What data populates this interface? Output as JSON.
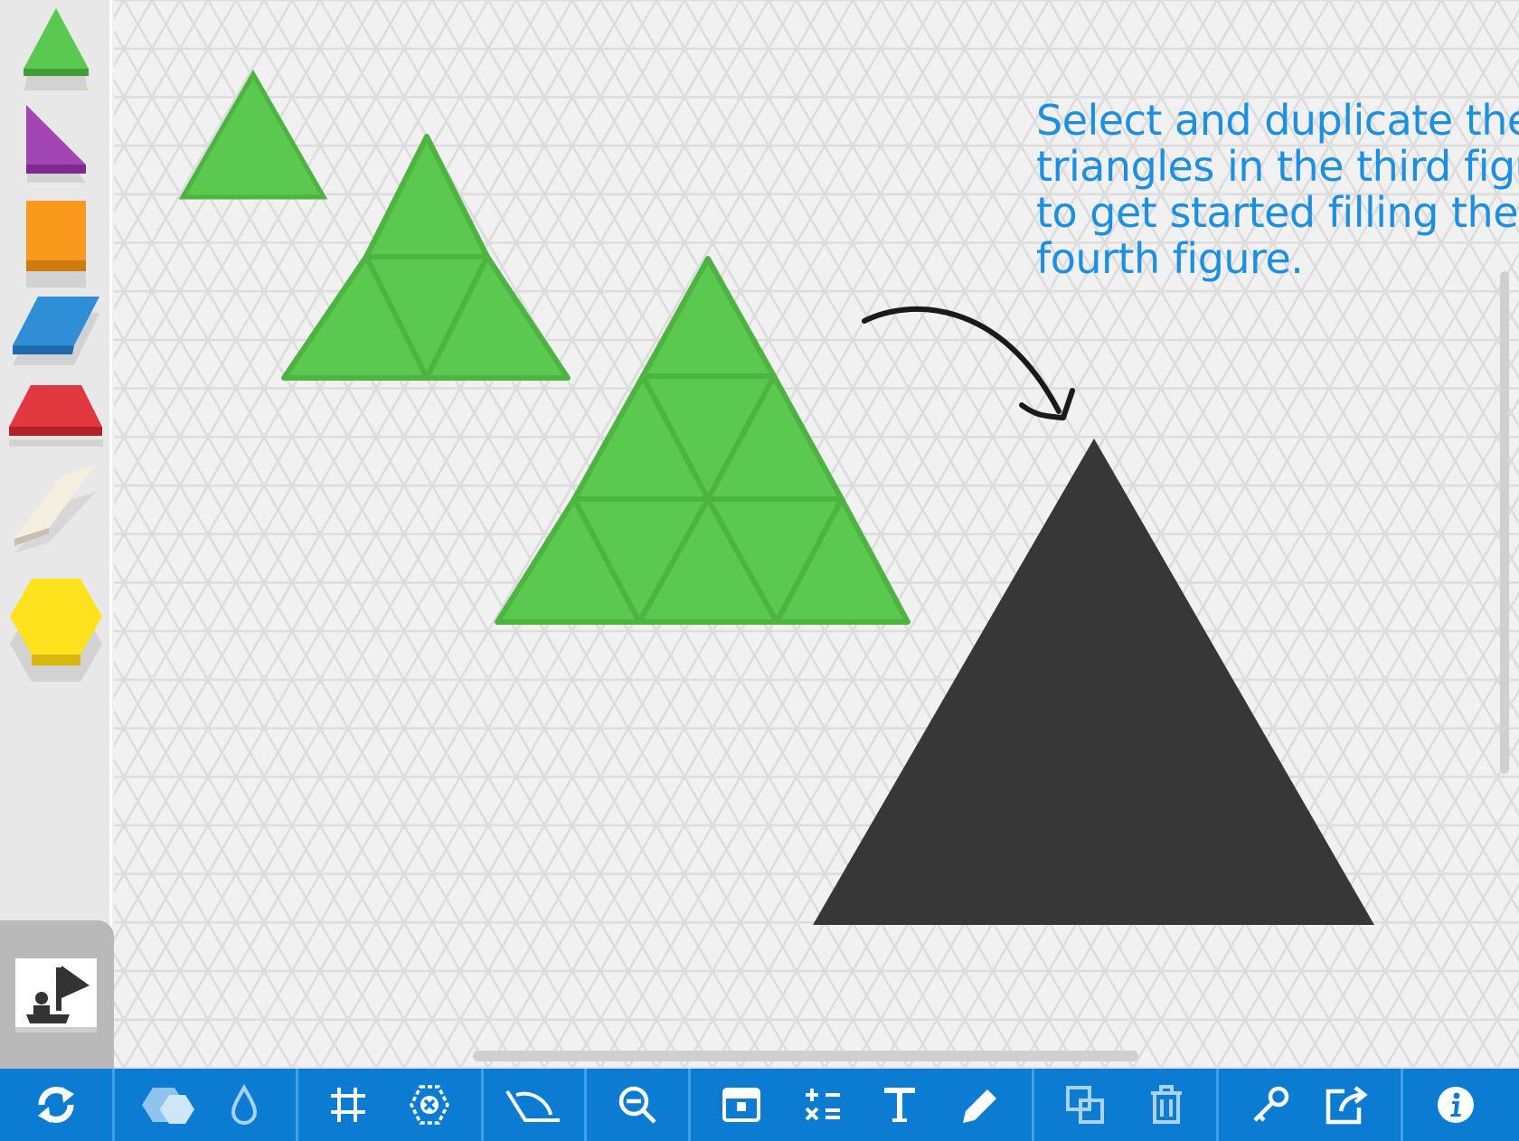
{
  "instructions": {
    "line1": "Select and duplicate the",
    "line2": "triangles in the third figure",
    "line3": "to get started filling the",
    "line4": "fourth figure."
  },
  "palette": {
    "shapes": [
      "triangle-icon",
      "right-triangle-icon",
      "square-icon",
      "rhombus-icon",
      "trapezoid-icon",
      "thin-rhombus-icon",
      "hexagon-icon"
    ],
    "colors": {
      "triangle": "#5bc84f",
      "right_triangle": "#a346b5",
      "square": "#f99a1c",
      "rhombus": "#2f8ed6",
      "trapezoid": "#e2383f",
      "thin_rhombus": "#f5efdf",
      "hexagon": "#fde21d"
    }
  },
  "canvas_colors": {
    "grid_line": "#dcdcdc",
    "green_piece": "#5bc84f",
    "green_outline": "#4db341",
    "target": "#373737",
    "arrow": "#1a1a1a"
  },
  "toolbar": {
    "background": "#0c7cd3",
    "icons": [
      "refresh-icon",
      "shapes-icon",
      "color-fill-icon",
      "grid-icon",
      "snap-icon",
      "angle-icon",
      "zoom-out-icon",
      "reveal-icon",
      "math-ops-icon",
      "text-icon",
      "pencil-icon",
      "duplicate-icon",
      "trash-icon",
      "key-icon",
      "share-icon",
      "info-icon"
    ]
  }
}
